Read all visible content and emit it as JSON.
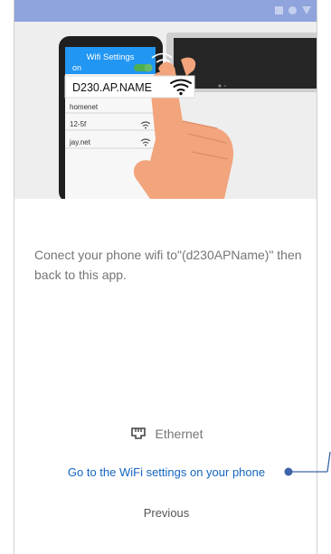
{
  "hero": {
    "wifi_settings_title": "Wifi Settings",
    "toggle_label": "on",
    "selected_network": "D230.AP.NAME",
    "networks": [
      {
        "name": "homenet"
      },
      {
        "name": "12-5f"
      },
      {
        "name": "jay.net"
      }
    ]
  },
  "instruction": "Conect your phone wifi to\"(d230APName)\" then back to this app.",
  "ethernet": {
    "label": "Ethernet",
    "icon": "ethernet-port-icon"
  },
  "actions": {
    "wifi_settings_link": "Go to the WiFi settings on your phone",
    "previous": "Previous"
  },
  "colors": {
    "status_bar": "#8fa3dc",
    "link": "#1565c0",
    "wifi_header": "#2196f3",
    "toggle_on": "#4caf50",
    "hand": "#f2a47c",
    "callout": "#3d64a8"
  }
}
